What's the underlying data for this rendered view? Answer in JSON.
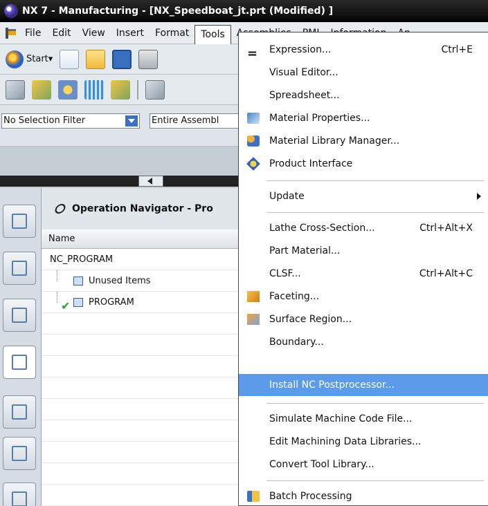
{
  "window": {
    "title": "NX 7 - Manufacturing - [NX_Speedboat_jt.prt (Modified) ]"
  },
  "menubar": {
    "items": [
      "File",
      "Edit",
      "View",
      "Insert",
      "Format",
      "Tools",
      "Assemblies",
      "PMI",
      "Information",
      "An"
    ],
    "active": "Tools"
  },
  "toolbar": {
    "start_label": "Start▾"
  },
  "selection_bar": {
    "filter_value": "No Selection Filter",
    "scope_value": "Entire Assembl"
  },
  "navigator": {
    "title": "Operation Navigator - Pro",
    "column_name": "Name",
    "rows": [
      {
        "label": "NC_PROGRAM",
        "level": 0
      },
      {
        "label": "Unused Items",
        "level": 1
      },
      {
        "label": "PROGRAM",
        "level": 1,
        "checked": true
      }
    ]
  },
  "tools_menu": {
    "items": [
      {
        "label": "Expression...",
        "shortcut": "Ctrl+E",
        "icon": "expression-icon"
      },
      {
        "label": "Visual Editor...",
        "shortcut": ""
      },
      {
        "label": "Spreadsheet...",
        "shortcut": ""
      },
      {
        "label": "Material Properties...",
        "shortcut": "",
        "icon": "material-properties-icon"
      },
      {
        "label": "Material Library Manager...",
        "shortcut": "",
        "icon": "material-library-icon"
      },
      {
        "label": "Product Interface",
        "shortcut": "",
        "icon": "product-interface-icon"
      },
      {
        "label": "Update",
        "shortcut": "",
        "submenu": true
      },
      {
        "label": "Lathe Cross-Section...",
        "shortcut": "Ctrl+Alt+X"
      },
      {
        "label": "Part Material...",
        "shortcut": ""
      },
      {
        "label": "CLSF...",
        "shortcut": "Ctrl+Alt+C"
      },
      {
        "label": "Faceting...",
        "shortcut": "",
        "icon": "faceting-icon"
      },
      {
        "label": "Surface Region...",
        "shortcut": "",
        "icon": "surface-region-icon"
      },
      {
        "label": "Boundary...",
        "shortcut": ""
      },
      {
        "label": "Install NC Postprocessor...",
        "shortcut": "",
        "highlighted": true
      },
      {
        "label": "Simulate Machine Code File...",
        "shortcut": ""
      },
      {
        "label": "Edit Machining Data Libraries...",
        "shortcut": ""
      },
      {
        "label": "Convert Tool Library...",
        "shortcut": ""
      },
      {
        "label": "Batch Processing",
        "shortcut": "",
        "icon": "batch-processing-icon"
      }
    ]
  },
  "colors": {
    "highlight": "#5b9bea",
    "titlebar": "#101010"
  }
}
